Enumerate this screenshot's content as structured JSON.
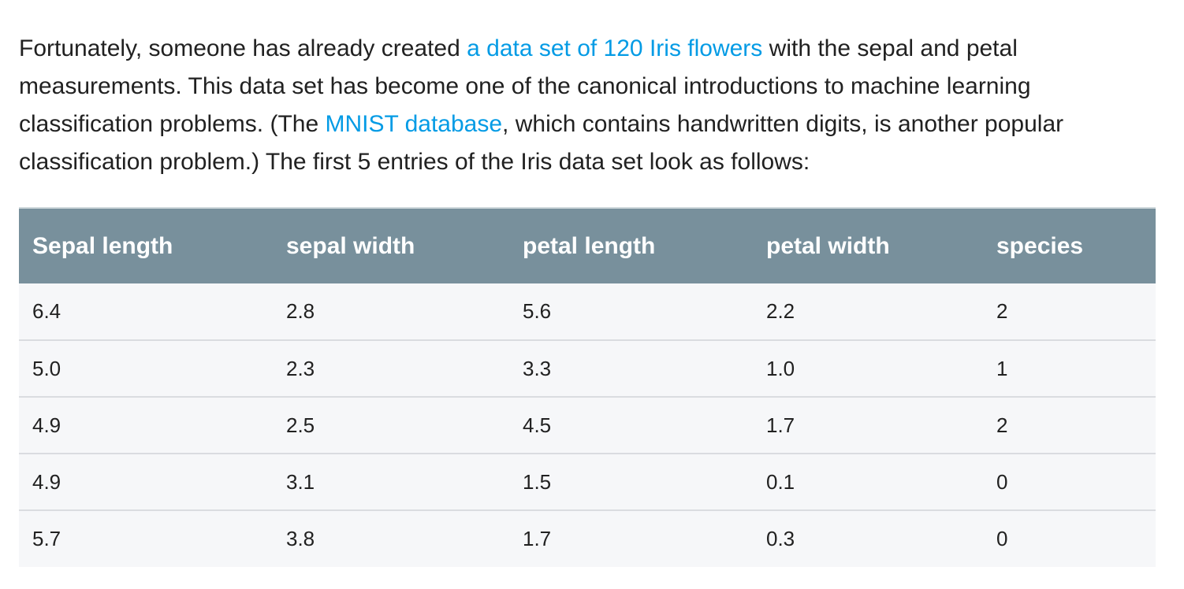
{
  "paragraph": {
    "line1_a": "Fortunately, someone has already created ",
    "link_iris": "a data set of 120 Iris flowers",
    "line1_b": " with the sepal and petal",
    "line2": "measurements. This data set has become one of the canonical introductions to machine learning",
    "line3_a": "classification problems. (The ",
    "link_mnist": "MNIST database",
    "line3_b": ", which contains handwritten digits, is another popular",
    "line4": "classification problem.) The first 5 entries of the Iris data set look as follows:"
  },
  "colors": {
    "link": "#039be5",
    "header_bg": "#78909c",
    "row_bg": "#f6f7f9"
  },
  "table": {
    "headers": [
      "Sepal length",
      "sepal width",
      "petal length",
      "petal width",
      "species"
    ],
    "rows": [
      [
        "6.4",
        "2.8",
        "5.6",
        "2.2",
        "2"
      ],
      [
        "5.0",
        "2.3",
        "3.3",
        "1.0",
        "1"
      ],
      [
        "4.9",
        "2.5",
        "4.5",
        "1.7",
        "2"
      ],
      [
        "4.9",
        "3.1",
        "1.5",
        "0.1",
        "0"
      ],
      [
        "5.7",
        "3.8",
        "1.7",
        "0.3",
        "0"
      ]
    ]
  }
}
